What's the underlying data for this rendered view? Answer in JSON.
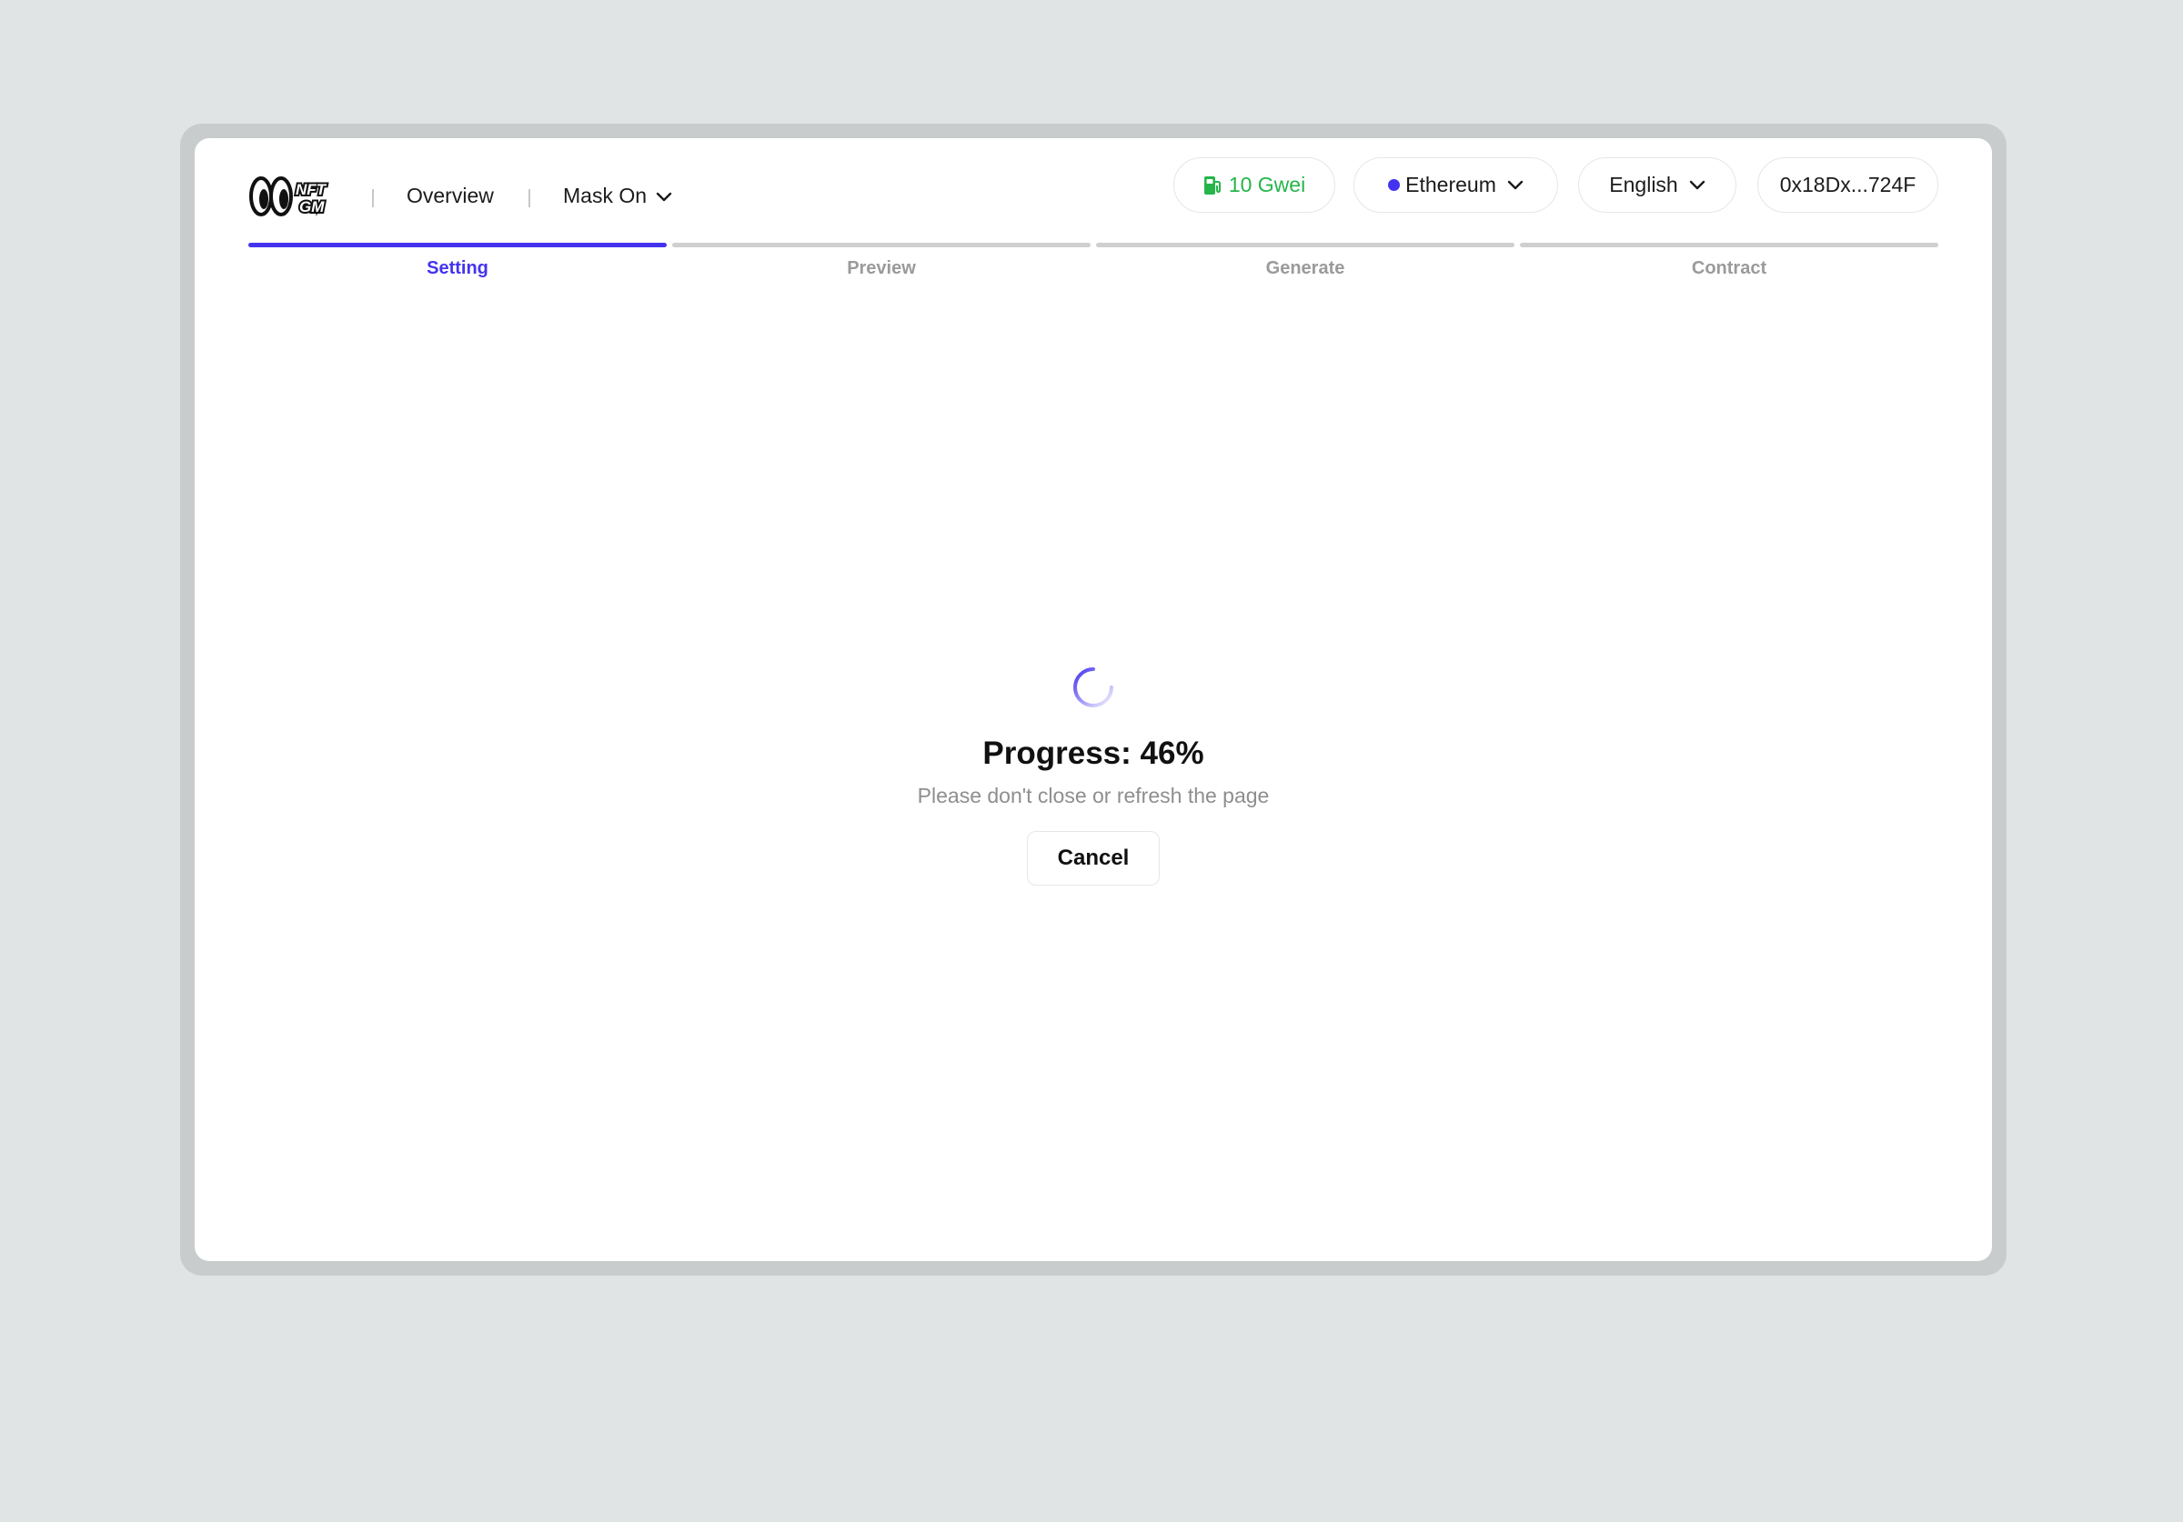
{
  "header": {
    "logo_text_top": "NFT",
    "logo_text_bottom": "GM",
    "nav": {
      "overview": "Overview",
      "mask_on": "Mask On"
    },
    "gas": {
      "label": "10 Gwei",
      "icon": "gas-pump-icon",
      "color": "#25b54a"
    },
    "network": {
      "label": "Ethereum",
      "dot_color": "#4433ee"
    },
    "language": {
      "label": "English"
    },
    "wallet": {
      "label": "0x18Dx...724F"
    }
  },
  "steps": [
    {
      "label": "Setting",
      "active": true
    },
    {
      "label": "Preview",
      "active": false
    },
    {
      "label": "Generate",
      "active": false
    },
    {
      "label": "Contract",
      "active": false
    }
  ],
  "progress": {
    "title": "Progress: 46%",
    "value_percent": 46,
    "subtitle": "Please don't close or refresh the page",
    "cancel_label": "Cancel"
  },
  "colors": {
    "accent": "#4433ee",
    "background": "#e1e4e5",
    "frame": "#c9cccc"
  }
}
